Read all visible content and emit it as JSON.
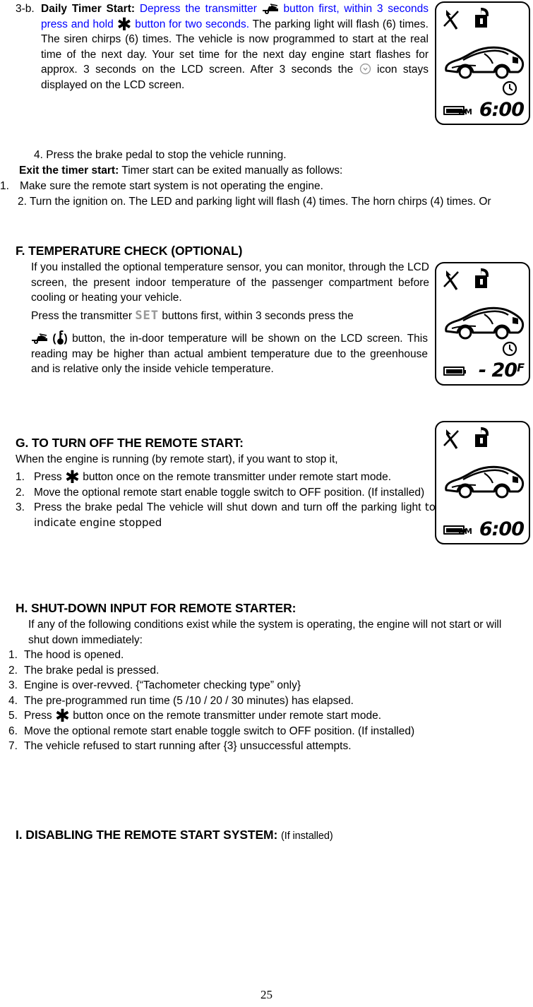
{
  "page": {
    "number": "25"
  },
  "section_3b": {
    "label": "3-b.",
    "title": "Daily Timer Start:",
    "blue_part_1": "Depress the transmitter",
    "blue_part_2": "button first, within 3 seconds press and hold",
    "blue_part_3": "button for two seconds.",
    "black_part_1": "The parking light will flash (6) times. The siren chirps (6) times. The vehicle is now programmed to start at the real time of the next day. Your set time for the next day engine start flashes for approx. 3 seconds on the LCD screen. After 3 seconds the",
    "black_part_2": "icon stays displayed on the LCD screen.",
    "step4": "4. Press the brake pedal to stop the vehicle running."
  },
  "exit_timer": {
    "label": "Exit the timer start:",
    "intro": "Timer start can be exited manually as follows:",
    "item1_num": "1.",
    "item1": "Make sure the remote start system is not operating the engine.",
    "item2": "2. Turn the ignition on. The LED and parking light will flash (4) times. The horn chirps (4) times.   Or"
  },
  "section_F": {
    "heading": "F. TEMPERATURE CHECK (OPTIONAL)",
    "para1": "If you installed the optional temperature sensor, you can monitor, through the LCD screen, the present indoor temperature of the passenger compartment before cooling or heating your vehicle.",
    "press_pre": "Press the transmitter",
    "set_label": "SET",
    "press_mid": "buttons first, within 3 seconds press the",
    "open_paren": "(",
    "close_paren": ")",
    "para2": "button, the in-door temperature will be shown on the LCD screen. This reading may be higher than actual ambient temperature due to the greenhouse and is relative only the inside vehicle temperature."
  },
  "section_G": {
    "heading": "G. TO TURN OFF THE REMOTE START:",
    "intro": "When the engine is running (by remote start), if you want to stop it,",
    "items": [
      {
        "n": "1.",
        "pre": "Press",
        "post": "button once on the remote transmitter under remote start mode.",
        "has_star": true
      },
      {
        "n": "2.",
        "text": "Move the optional remote start enable toggle switch to OFF position. (If installed)",
        "has_star": false
      },
      {
        "n": "3.",
        "pre": "Press the brake pedal The vehicle will shut down and turn off the parking light",
        "alt": "to indicate engine stopped",
        "has_star": false
      }
    ]
  },
  "section_H": {
    "heading": "H. SHUT-DOWN INPUT FOR REMOTE STARTER:",
    "intro": "If any of the following conditions exist while the system is operating, the engine will not start or will shut down immediately:",
    "items": [
      {
        "n": "1.",
        "text": "The hood is opened."
      },
      {
        "n": "2.",
        "text": "The brake pedal is pressed."
      },
      {
        "n": "3.",
        "text": "Engine is over-revved. {“Tachometer checking type” only}"
      },
      {
        "n": "4.",
        "text": "The pre-programmed run time (5 /10 / 20 / 30 minutes) has elapsed."
      },
      {
        "n": "5.",
        "pre": "Press",
        "post": "button once on the remote transmitter under remote start mode.",
        "has_star": true
      },
      {
        "n": "6.",
        "text": "Move the optional remote start enable toggle switch to OFF position. (If installed)"
      },
      {
        "n": "7.",
        "text": "The vehicle refused to start running after {3} unsuccessful attempts."
      }
    ]
  },
  "section_I": {
    "heading": "I. DISABLING THE REMOTE START SYSTEM:",
    "sub": "(If installed)"
  },
  "lcd_displays": [
    {
      "id": "lcd-timer-start",
      "antenna": "antenna-crossed-icon",
      "lock": "lock-open-icon",
      "car": "car-icon",
      "clock": true,
      "battery": "battery-full-icon",
      "ampm": "AM",
      "readout": "6:00",
      "unit": ""
    },
    {
      "id": "lcd-temperature",
      "antenna": "antenna-crossed-icon",
      "lock": "lock-open-icon",
      "car": "car-icon",
      "clock": true,
      "battery": "battery-full-icon",
      "ampm": "",
      "readout": "- 20",
      "unit": "F"
    },
    {
      "id": "lcd-remote-off",
      "antenna": "antenna-crossed-icon",
      "lock": "lock-open-icon",
      "car": "car-icon",
      "clock": false,
      "battery": "battery-full-icon",
      "ampm": "AM",
      "readout": "6:00",
      "unit": ""
    }
  ],
  "icons": {
    "star": "✱",
    "engine_button": "engine-start-icon",
    "thermometer": "thermometer-icon",
    "clock": "clock-icon"
  },
  "colors": {
    "blue": "#0000ff",
    "text": "#000000",
    "set_gray": "#9a9a9a"
  }
}
